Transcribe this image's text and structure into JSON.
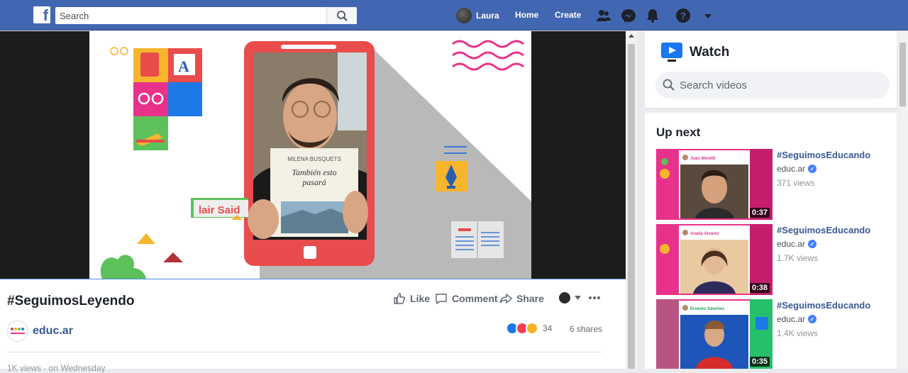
{
  "topbar": {
    "search_placeholder": "Search",
    "user_name": "Laura",
    "home_label": "Home",
    "create_label": "Create",
    "brand_color": "#4267b2"
  },
  "video": {
    "title": "#SeguimosLeyendo",
    "actions": {
      "like": "Like",
      "comment": "Comment",
      "share": "Share"
    },
    "page_name": "educ.ar",
    "reaction_count": "34",
    "shares": "6 shares",
    "meta": "1K views · on Wednesday",
    "frame": {
      "book_author": "MILENA BUSQUETS",
      "book_title_1": "También esto",
      "book_title_2": "pasará",
      "sign_label": "lair Said"
    }
  },
  "watch": {
    "title": "Watch",
    "search_placeholder": "Search videos",
    "up_next_label": "Up next",
    "items": [
      {
        "title": "#SeguimosEducando",
        "channel": "educ.ar",
        "views": "371 views",
        "duration": "0:37",
        "presenter": "Juan Moretti",
        "accent": "#e8318a"
      },
      {
        "title": "#SeguimosEducando",
        "channel": "educ.ar",
        "views": "1.7K views",
        "duration": "0:38",
        "presenter": "Analia Alvarez",
        "accent": "#e8318a"
      },
      {
        "title": "#SeguimosEducando",
        "channel": "educ.ar",
        "views": "1.4K views",
        "duration": "0:35",
        "presenter": "Ernesto Sánchez",
        "accent": "#27c06a"
      }
    ]
  }
}
